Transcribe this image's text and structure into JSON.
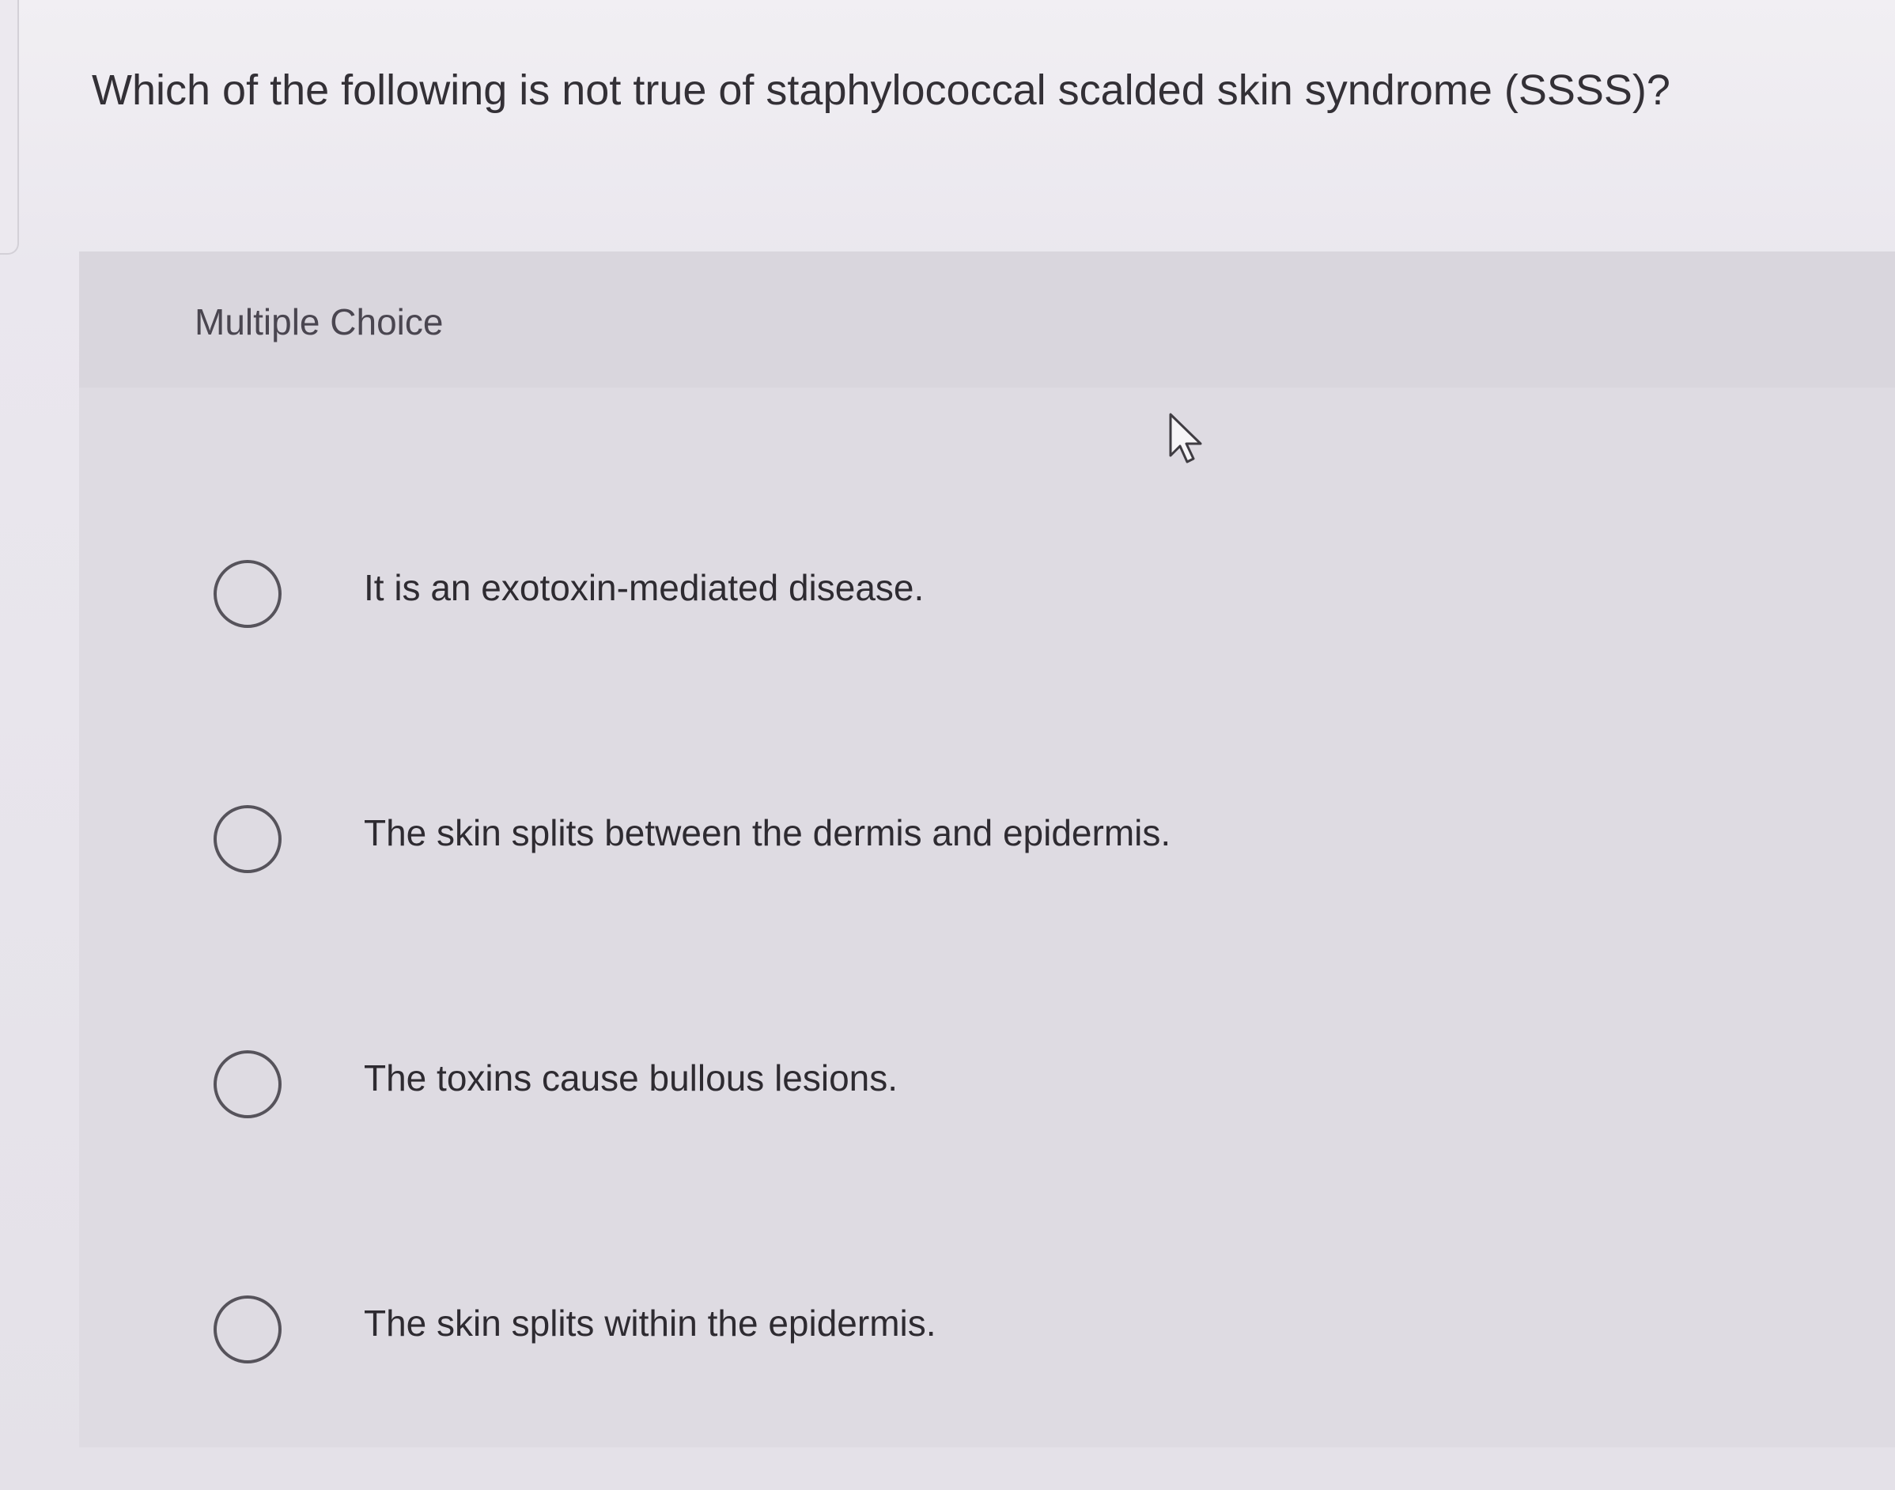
{
  "question": {
    "text": "Which of the following is not true of staphylococcal scalded skin syndrome (SSSS)?"
  },
  "panel": {
    "label": "Multiple Choice"
  },
  "options": [
    {
      "label": "It is an exotoxin-mediated disease.",
      "selected": false
    },
    {
      "label": "The skin splits between the dermis and epidermis.",
      "selected": false
    },
    {
      "label": "The toxins cause bullous lesions.",
      "selected": false
    },
    {
      "label": "The skin splits within the epidermis.",
      "selected": false
    }
  ],
  "icons": {
    "cursor": "mouse-pointer-icon",
    "radio": "radio-button-icon"
  },
  "colors": {
    "background": "#e7e4ea",
    "panel": "#dedbe2",
    "text": "#2f2c33",
    "radio_border": "#56535b"
  }
}
